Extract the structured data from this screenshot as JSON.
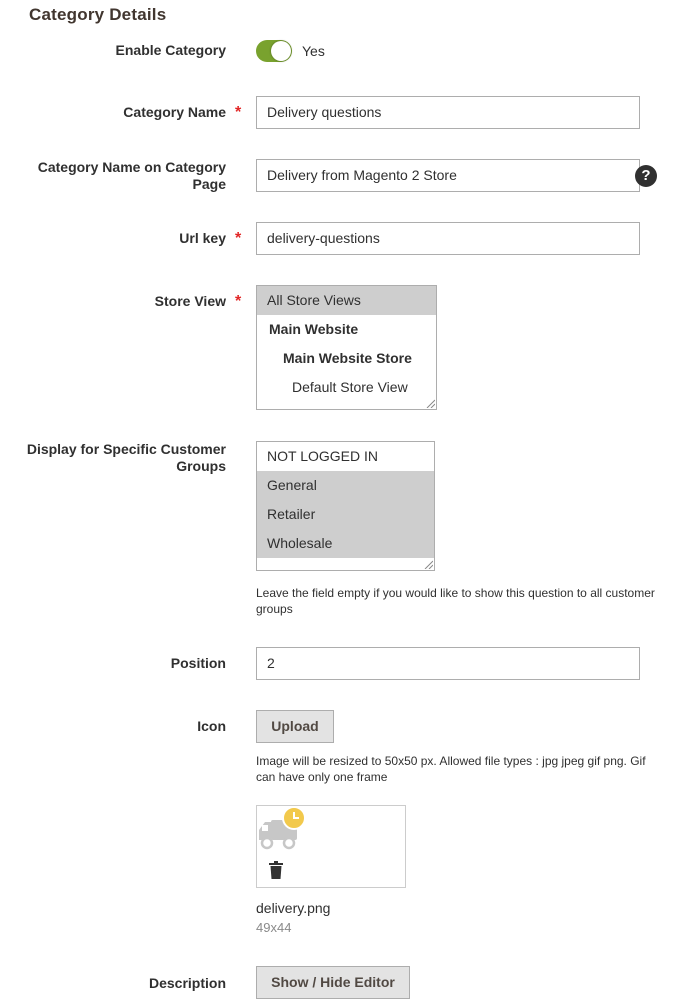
{
  "section": {
    "title": "Category Details"
  },
  "enable_category": {
    "label": "Enable Category",
    "value": "Yes",
    "checked": true
  },
  "category_name": {
    "label": "Category Name",
    "value": "Delivery questions",
    "required": true
  },
  "category_page_name": {
    "label": "Category Name on Category Page",
    "value": "Delivery from Magento 2 Store",
    "help": "?"
  },
  "url_key": {
    "label": "Url key",
    "value": "delivery-questions",
    "required": true
  },
  "store_view": {
    "label": "Store View",
    "required": true,
    "options": [
      {
        "label": "All Store Views",
        "selected": true
      },
      {
        "label": "Main Website",
        "selected": false
      },
      {
        "label": "Main Website Store",
        "selected": false
      },
      {
        "label": "Default Store View",
        "selected": false
      }
    ]
  },
  "customer_groups": {
    "label": "Display for Specific Customer Groups",
    "options": [
      {
        "label": "NOT LOGGED IN",
        "selected": false
      },
      {
        "label": "General",
        "selected": true
      },
      {
        "label": "Retailer",
        "selected": true
      },
      {
        "label": "Wholesale",
        "selected": true
      }
    ],
    "note": "Leave the field empty if you would like to show this question to all customer groups"
  },
  "position": {
    "label": "Position",
    "value": "2"
  },
  "icon": {
    "label": "Icon",
    "upload_label": "Upload",
    "note": "Image will be resized to 50x50 px. Allowed file types : jpg jpeg gif png. Gif can have only one frame",
    "file_name": "delivery.png",
    "file_dims": "49x44",
    "image_icon": "delivery-truck-clock-icon",
    "delete_icon": "trash-icon"
  },
  "description": {
    "label": "Description",
    "button_label": "Show / Hide Editor"
  },
  "colors": {
    "accent_toggle": "#79a22e",
    "required": "#e22626",
    "clock": "#f2c94c",
    "truck": "#c7c7c7"
  }
}
